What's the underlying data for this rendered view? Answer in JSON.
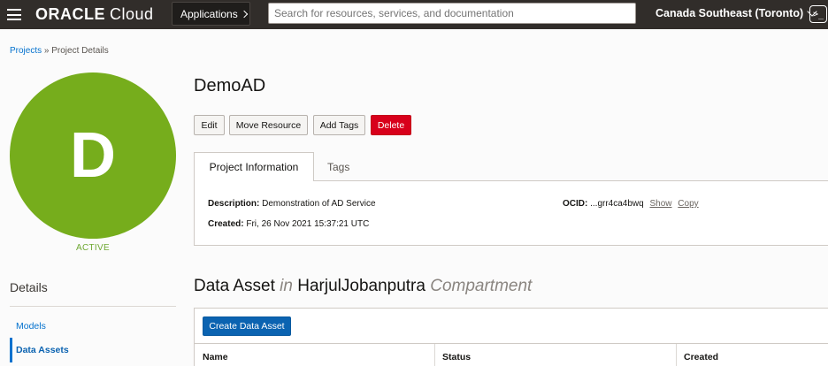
{
  "header": {
    "logo_brand": "ORACLE",
    "logo_product": "Cloud",
    "applications_label": "Applications",
    "search_placeholder": "Search for resources, services, and documentation",
    "region_label": "Canada Southeast (Toronto)",
    "shell_symbol": ">_"
  },
  "breadcrumb": {
    "link": "Projects",
    "separator": " » ",
    "current": "Project Details"
  },
  "project": {
    "initial": "D",
    "status": "ACTIVE",
    "name": "DemoAD",
    "color": "#76ad1c"
  },
  "actions": {
    "edit": "Edit",
    "move": "Move Resource",
    "add_tags": "Add Tags",
    "delete": "Delete"
  },
  "tabs": {
    "info": "Project Information",
    "tags": "Tags"
  },
  "info": {
    "description_label": "Description:",
    "description_value": "Demonstration of AD Service",
    "created_label": "Created:",
    "created_value": "Fri, 26 Nov 2021 15:37:21 UTC",
    "ocid_label": "OCID:",
    "ocid_value": "...grr4ca4bwq",
    "ocid_show": "Show",
    "ocid_copy": "Copy"
  },
  "sidebar": {
    "heading": "Details",
    "items": [
      {
        "label": "Models"
      },
      {
        "label": "Data Assets"
      }
    ]
  },
  "section": {
    "title_main": "Data Asset",
    "title_in": "in",
    "compartment": "HarjulJobanputra",
    "title_suffix": "Compartment",
    "create_button": "Create Data Asset"
  },
  "table": {
    "columns": [
      "Name",
      "Status",
      "Created"
    ]
  }
}
